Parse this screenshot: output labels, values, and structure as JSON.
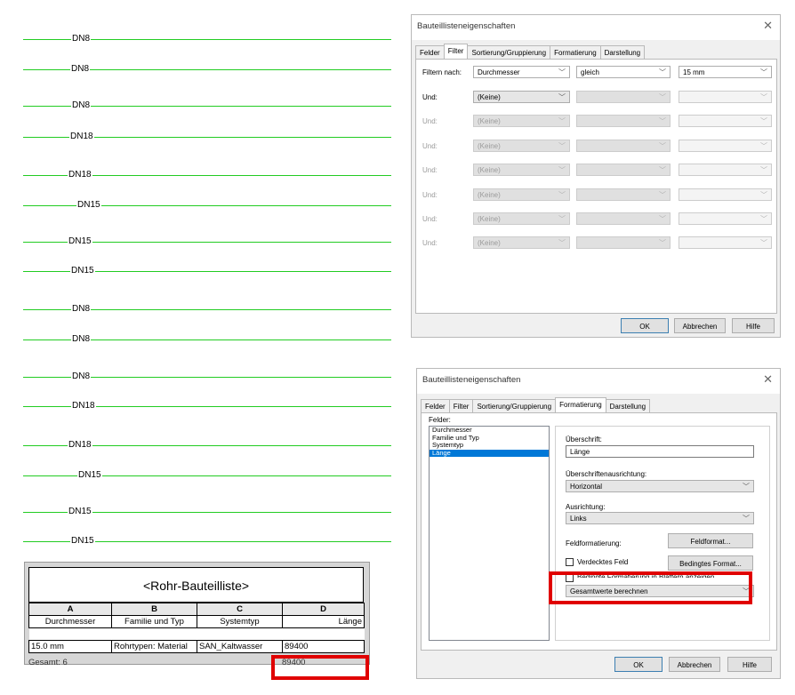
{
  "pipes": [
    "DN8",
    "DN8",
    "DN8",
    "DN18",
    "DN18",
    "DN15",
    "DN15",
    "DN15",
    "DN8",
    "DN8",
    "DN8",
    "DN18",
    "DN18",
    "DN15",
    "DN15",
    "DN15"
  ],
  "dialog_filter": {
    "title": "Bauteillisteneigenschaften",
    "tabs": [
      "Felder",
      "Filter",
      "Sortierung/Gruppierung",
      "Formatierung",
      "Darstellung"
    ],
    "active_tab": "Filter",
    "filter_label": "Filtern nach:",
    "and_label": "Und:",
    "filter_row": {
      "field": "Durchmesser",
      "operator": "gleich",
      "value": "15 mm"
    },
    "none_option": "(Keine)",
    "ok": "OK",
    "cancel": "Abbrechen",
    "help": "Hilfe"
  },
  "dialog_format": {
    "title": "Bauteillisteneigenschaften",
    "tabs": [
      "Felder",
      "Filter",
      "Sortierung/Gruppierung",
      "Formatierung",
      "Darstellung"
    ],
    "active_tab": "Formatierung",
    "fields_label": "Felder:",
    "fields": [
      "Durchmesser",
      "Familie und Typ",
      "Systemtyp",
      "Länge"
    ],
    "selected_field": "Länge",
    "heading_label": "Überschrift:",
    "heading_value": "Länge",
    "heading_align_label": "Überschriftenausrichtung:",
    "heading_align_value": "Horizontal",
    "align_label": "Ausrichtung:",
    "align_value": "Links",
    "field_format_label": "Feldformatierung:",
    "field_format_button": "Feldformat...",
    "hidden_field_label": "Verdecktes Feld",
    "conditional_format_button": "Bedingtes Format...",
    "conditional_show_label": "Bedingte Formatierung in Blättern anzeigen",
    "totals_value": "Gesamtwerte berechnen",
    "ok": "OK",
    "cancel": "Abbrechen",
    "help": "Hilfe"
  },
  "schedule": {
    "title": "<Rohr-Bauteilliste>",
    "letters": [
      "A",
      "B",
      "C",
      "D"
    ],
    "headers": [
      "Durchmesser",
      "Familie und Typ",
      "Systemtyp",
      "Länge"
    ],
    "row": [
      "15.0 mm",
      "Rohrtypen: Material",
      "SAN_Kaltwasser",
      "89400"
    ],
    "total_label": "Gesamt: 6",
    "total_value": "89400"
  },
  "colors": {
    "pipe": "#22cc22",
    "highlight": "#e00000",
    "selection": "#0078d7"
  }
}
